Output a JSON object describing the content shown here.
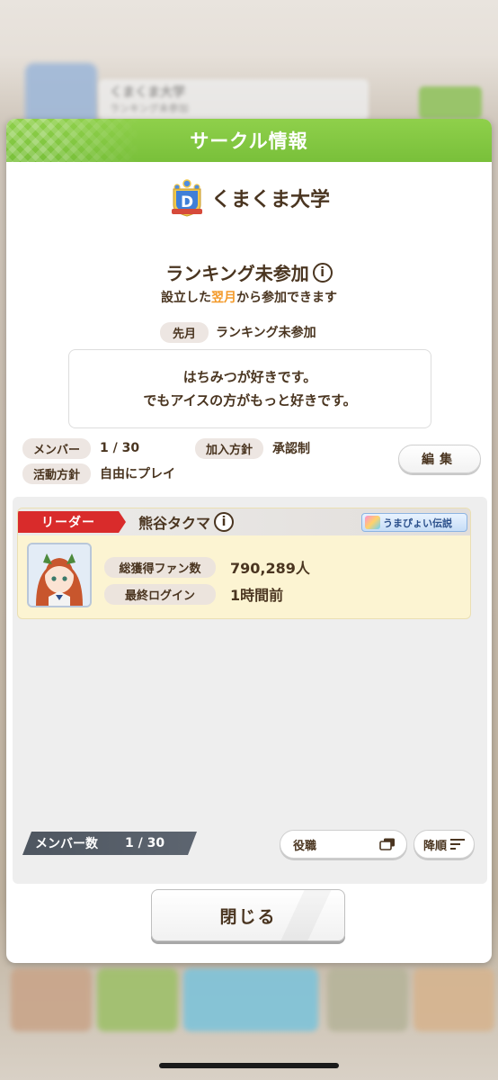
{
  "background": {
    "banner_title": "くまくま大学",
    "banner_subtitle": "ランキング未参加"
  },
  "dialog": {
    "title": "サークル情報",
    "circle_name": "くまくま大学",
    "crest_letter": "D",
    "ranking": {
      "status": "ランキング未参加",
      "info_label": "i",
      "note_prefix": "設立した",
      "note_highlight": "翌月",
      "note_suffix": "から参加できます",
      "last_month_label": "先月",
      "last_month_value": "ランキング未参加"
    },
    "description": {
      "line1": "はちみつが好きです。",
      "line2": "でもアイスの方がもっと好きです。"
    },
    "info": {
      "members_label": "メンバー",
      "members_value": "1 / 30",
      "join_policy_label": "加入方針",
      "join_policy_value": "承認制",
      "activity_policy_label": "活動方針",
      "activity_policy_value": "自由にプレイ",
      "edit_label": "編集"
    },
    "leader_card": {
      "role_tag": "リーダー",
      "name": "熊谷タクマ",
      "info_label": "i",
      "title_badge": "うまぴょい伝説",
      "fans_label": "総獲得ファン数",
      "fans_value": "790,289人",
      "last_login_label": "最終ログイン",
      "last_login_value": "1時間前"
    },
    "footer": {
      "member_count_label": "メンバー数",
      "member_count_value": "1 / 30",
      "sort_role_label": "役職",
      "sort_order_label": "降順",
      "close_label": "閉じる"
    }
  },
  "colors": {
    "header_green": "#86c943",
    "text_brown": "#4a3520",
    "highlight_orange": "#f39a2a",
    "leader_red": "#d92b2b",
    "card_yellow": "#fcf4d2"
  }
}
